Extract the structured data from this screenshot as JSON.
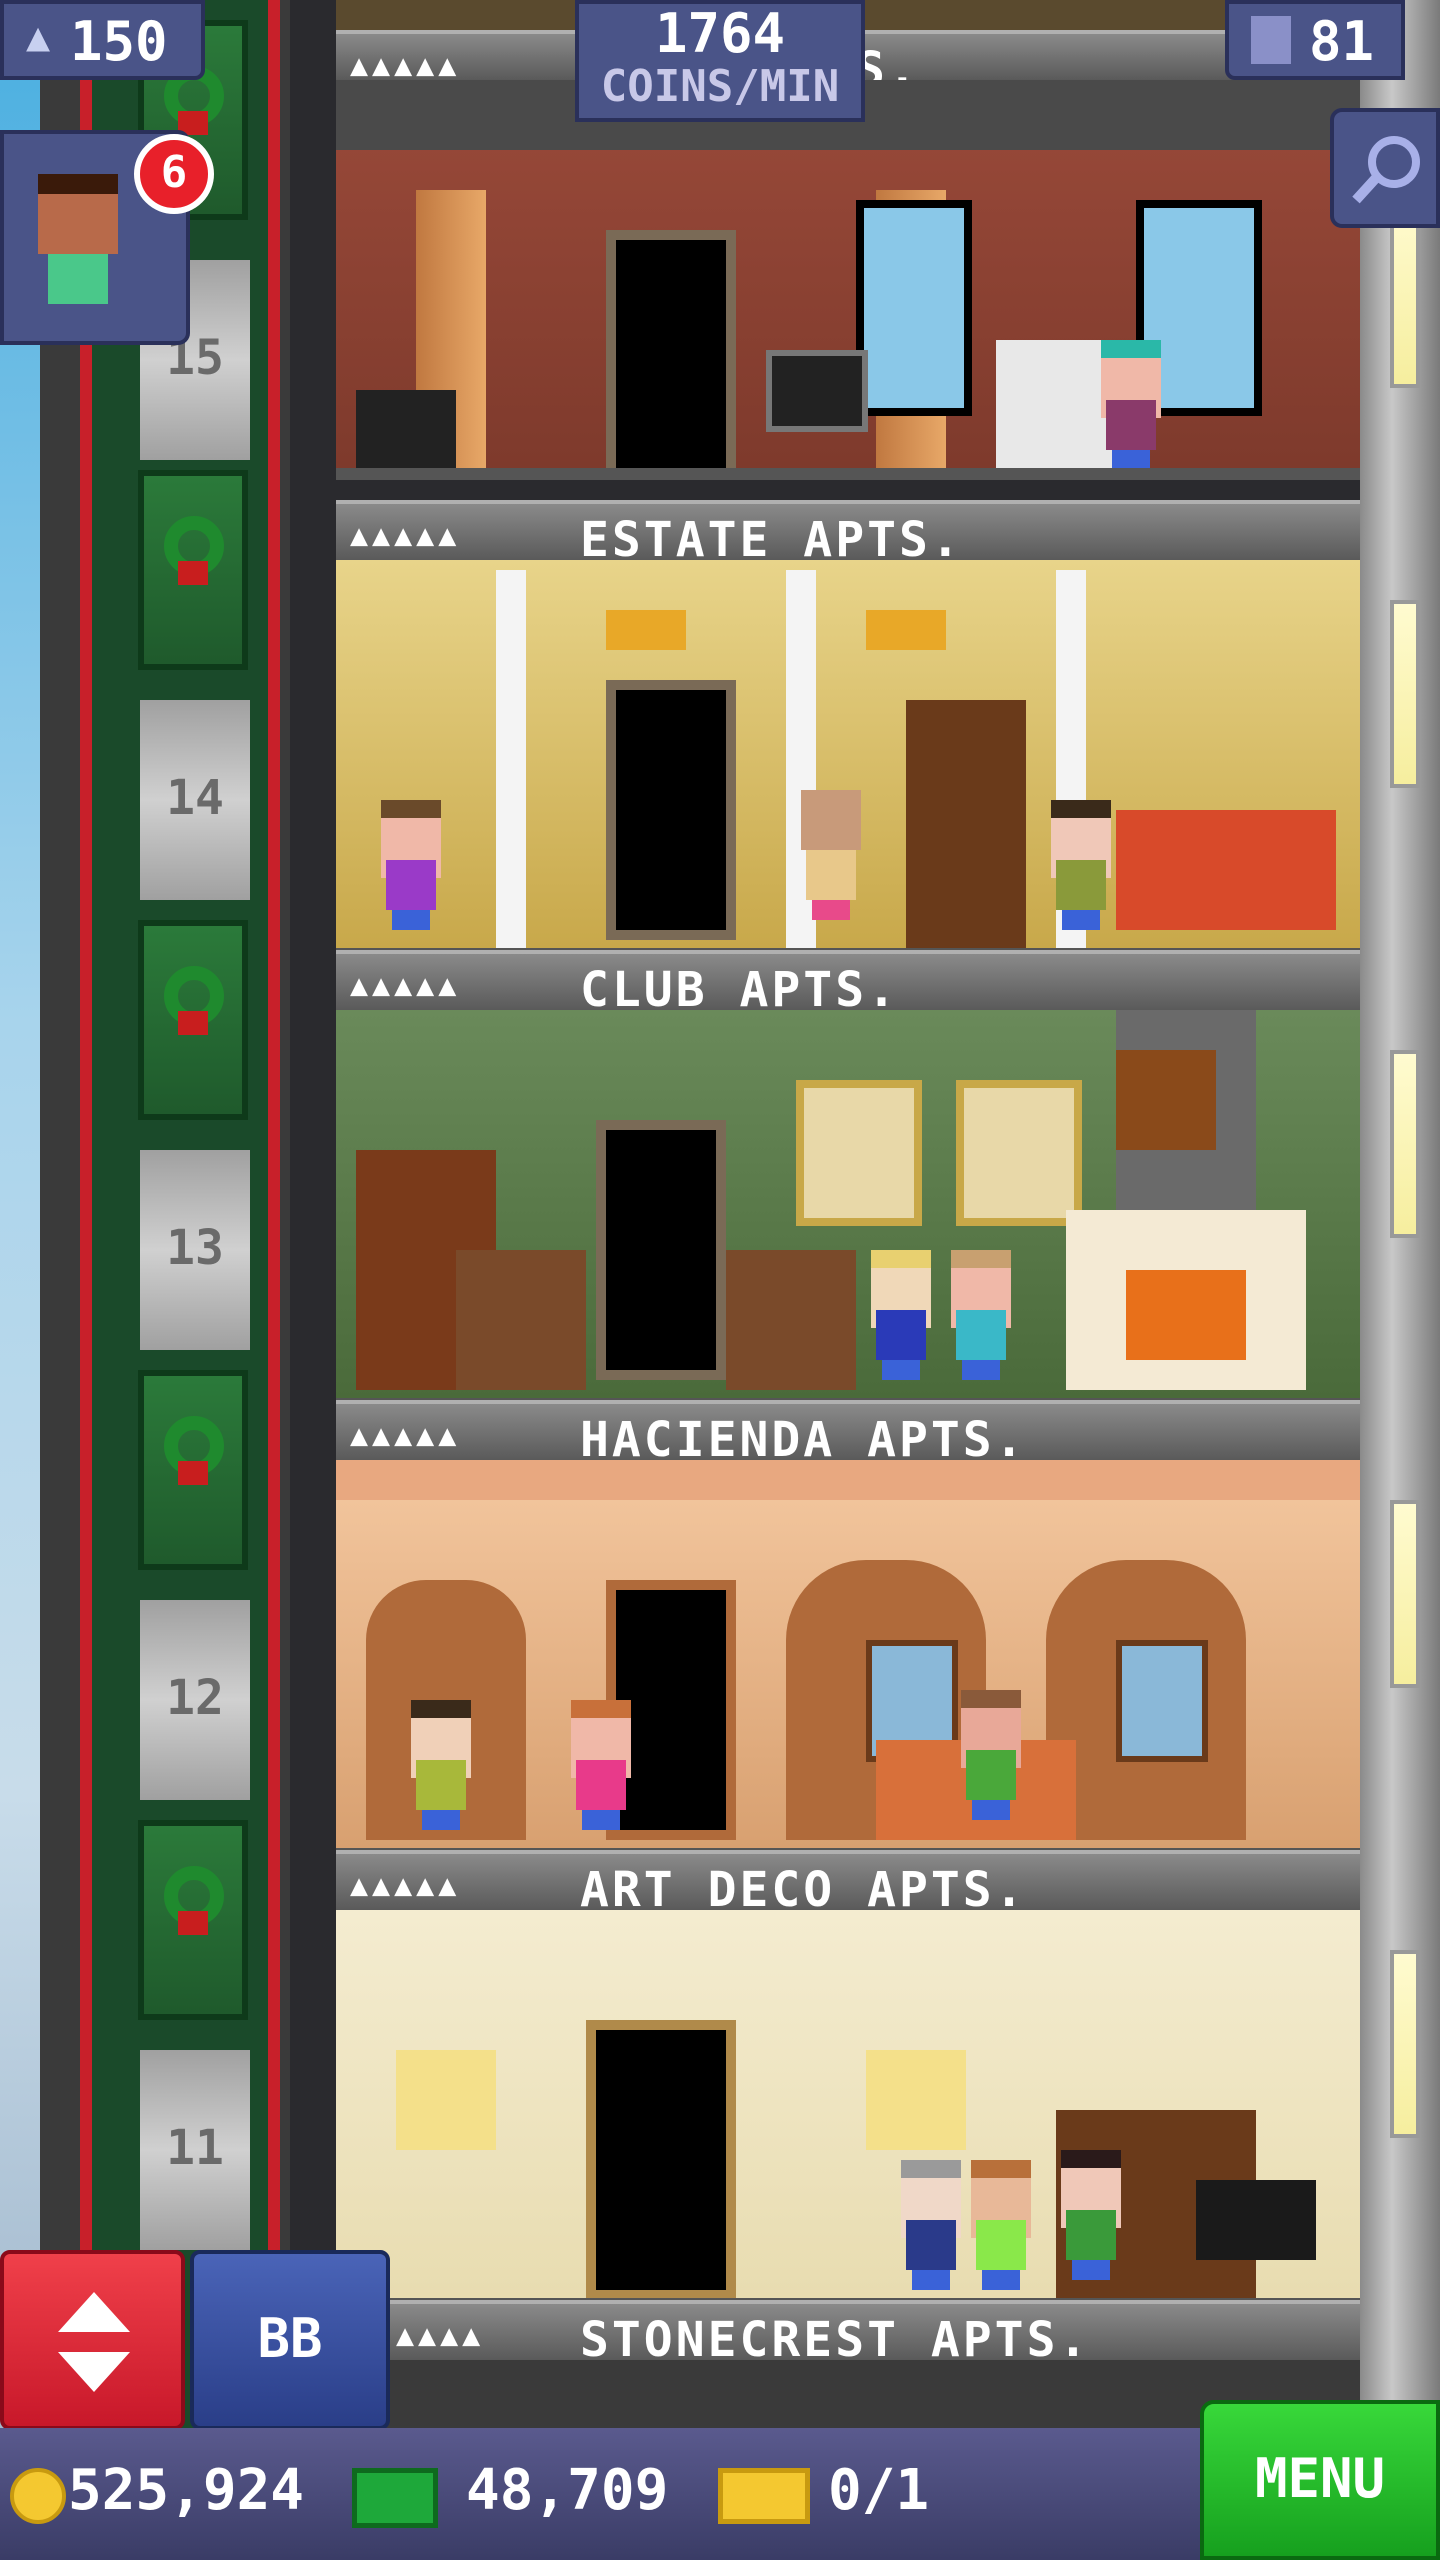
{
  "header": {
    "population": "150",
    "coins_per_min_value": "1764",
    "coins_per_min_label": "COINS/MIN",
    "floor_count": "81"
  },
  "floors": [
    {
      "number": "15",
      "name": "",
      "pips": "▲▲▲▲▲"
    },
    {
      "number": "14",
      "name": "ESTATE APTS.",
      "pips": "▲▲▲▲▲"
    },
    {
      "number": "13",
      "name": "CLUB APTS.",
      "pips": "▲▲▲▲▲"
    },
    {
      "number": "12",
      "name": "HACIENDA APTS.",
      "pips": "▲▲▲▲▲"
    },
    {
      "number": "11",
      "name": "ART DECO APTS.",
      "pips": "▲▲▲▲▲"
    },
    {
      "number": "",
      "name": "STONECREST APTS.",
      "pips": "▲▲▲▲"
    }
  ],
  "top_partial_label": "S.",
  "notification": {
    "count": "6"
  },
  "controls": {
    "elevator_button": "elevator-up-down",
    "bb_label": "BB"
  },
  "status": {
    "coins": "525,924",
    "bux": "48,709",
    "tickets": "0/1",
    "menu_label": "MENU"
  },
  "colors": {
    "menu_green": "#22b82a",
    "elevator_red": "#e8283a",
    "bb_blue": "#3a50a0"
  }
}
